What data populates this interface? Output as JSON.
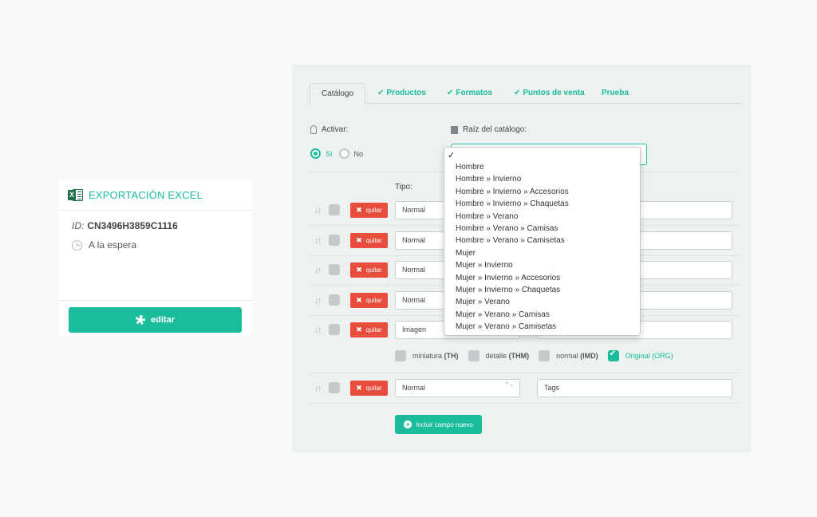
{
  "export_card": {
    "title": "EXPORTACIÓN EXCEL",
    "excel_badge": "X",
    "id_label": "ID:",
    "id_value": "CN3496H3859C1116",
    "status": "A la espera",
    "edit_label": "editar"
  },
  "tabs": [
    {
      "label": "Catálogo",
      "active": true,
      "checked": false
    },
    {
      "label": "Productos",
      "active": false,
      "checked": true
    },
    {
      "label": "Formatos",
      "active": false,
      "checked": true
    },
    {
      "label": "Puntos de venta",
      "active": false,
      "checked": true
    },
    {
      "label": "Prueba",
      "active": false,
      "checked": false
    }
  ],
  "check_glyph": "✔",
  "activate": {
    "label": "Activar:",
    "options": [
      {
        "label": "Sí",
        "selected": true
      },
      {
        "label": "No",
        "selected": false
      }
    ]
  },
  "catalog_root": {
    "label": "Raíz del catálogo:",
    "selected_mark": "✓",
    "options": [
      "Hombre",
      "Hombre » Invierno",
      "Hombre » Invierno » Accesorios",
      "Hombre » Invierno » Chaquetas",
      "Hombre » Verano",
      "Hombre » Verano » Camisas",
      "Hombre » Verano » Camisetas",
      "Mujer",
      "Mujer » Invierno",
      "Mujer » Invierno » Accesorios",
      "Mujer » Invierno » Chaquetas",
      "Mujer » Verano",
      "Mujer » Verano » Camisas",
      "Mujer » Verano » Camisetas"
    ]
  },
  "fields": {
    "type_label": "Tipo:",
    "remove_label": "quitar",
    "remove_glyph": "✖",
    "sort_glyph": "↓↑",
    "select_arrows": "⌃⌄",
    "rows": [
      {
        "type": "Normal",
        "value": ""
      },
      {
        "type": "Normal",
        "value": ""
      },
      {
        "type": "Normal",
        "value": ""
      },
      {
        "type": "Normal",
        "value": ""
      },
      {
        "type": "Imagen",
        "value": ""
      },
      {
        "type": "Normal",
        "value": "Tags"
      }
    ],
    "image_options": [
      {
        "label": "miniatura",
        "code": "(TH)",
        "checked": false
      },
      {
        "label": "detalle",
        "code": "(THM)",
        "checked": false
      },
      {
        "label": "normal",
        "code": "(IMD)",
        "checked": false
      },
      {
        "label": "Original",
        "code": "(ORG)",
        "checked": true
      }
    ],
    "add_label": "Incluir campo nuevo",
    "add_glyph": "+"
  },
  "colors": {
    "accent": "#1abc9c",
    "danger": "#e74c3c",
    "excel_green": "#1e7145"
  }
}
